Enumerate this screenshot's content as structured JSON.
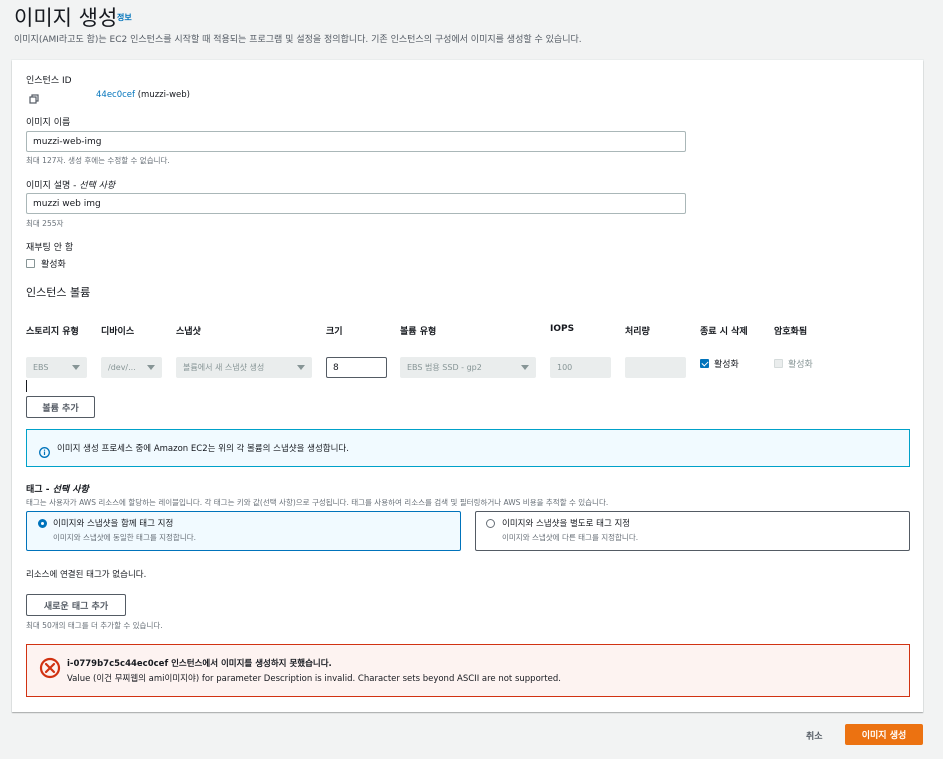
{
  "header": {
    "title": "이미지 생성",
    "info_link": "정보",
    "description": "이미지(AMI라고도 함)는 EC2 인스턴스를 시작할 때 적용되는 프로그램 및 설정을 정의합니다. 기존 인스턴스의 구성에서 이미지를 생성할 수 있습니다."
  },
  "instance": {
    "label": "인스턴스 ID",
    "value": "44ec0cef (muzzi-web)"
  },
  "image_name": {
    "label": "이미지 이름",
    "value": "muzzi-web-img",
    "hint": "최대 127자. 생성 후에는 수정할 수 없습니다."
  },
  "image_desc": {
    "label_main": "이미지 설명 - ",
    "label_optional": "선택 사항",
    "value": "muzzi web img",
    "hint": "최대 255자"
  },
  "no_reboot": {
    "label": "재부팅 안 함",
    "checkbox_label": "활성화",
    "checked": false
  },
  "volumes": {
    "heading": "인스턴스 볼륨",
    "columns": [
      "스토리지 유형",
      "디바이스",
      "스냅샷",
      "크기",
      "볼륨 유형",
      "IOPS",
      "처리량",
      "종료 시 삭제",
      "암호화됨"
    ],
    "row": {
      "storage_type": "EBS",
      "device": "/dev/...",
      "snapshot": "볼륨에서 새 스냅샷 생성",
      "size": "8",
      "volume_type": "EBS 범용 SSD - gp2",
      "iops": "100",
      "throughput": "",
      "delete_on_termination": "활성화",
      "encrypted": "활성화"
    },
    "add_button": "볼륨 추가"
  },
  "info_alert": "이미지 생성 프로세스 중에 Amazon EC2는 위의 각 볼륨의 스냅샷을 생성합니다.",
  "tags": {
    "label_main": "태그 - ",
    "label_optional": "선택 사항",
    "description": "태그는 사용자가 AWS 리소스에 할당하는 레이블입니다. 각 태그는 키와 값(선택 사항)으로 구성됩니다. 태그를 사용하여 리소스를 검색 및 필터링하거나 AWS 비용을 추적할 수 있습니다.",
    "option1_title": "이미지와 스냅샷을 함께 태그 지정",
    "option1_desc": "이미지와 스냅샷에 동일한 태그를 지정합니다.",
    "option2_title": "이미지와 스냅샷을 별도로 태그 지정",
    "option2_desc": "이미지와 스냅샷에 다른 태그를 지정합니다.",
    "empty_text": "리소스에 연결된 태그가 없습니다.",
    "add_button": "새로운 태그 추가",
    "limit_hint": "최대 50개의 태그를 더 추가할 수 있습니다."
  },
  "error": {
    "title": "i-0779b7c5c44ec0cef 인스턴스에서 이미지를 생성하지 못했습니다.",
    "message": "Value (이건 무찌웹의 ami이미지야) for parameter Description is invalid. Character sets beyond ASCII are not supported."
  },
  "footer": {
    "cancel": "취소",
    "submit": "이미지 생성"
  },
  "colors": {
    "accent": "#0073bb",
    "primary_button": "#ec7211",
    "error": "#d13212",
    "info_border": "#00a1c9"
  }
}
